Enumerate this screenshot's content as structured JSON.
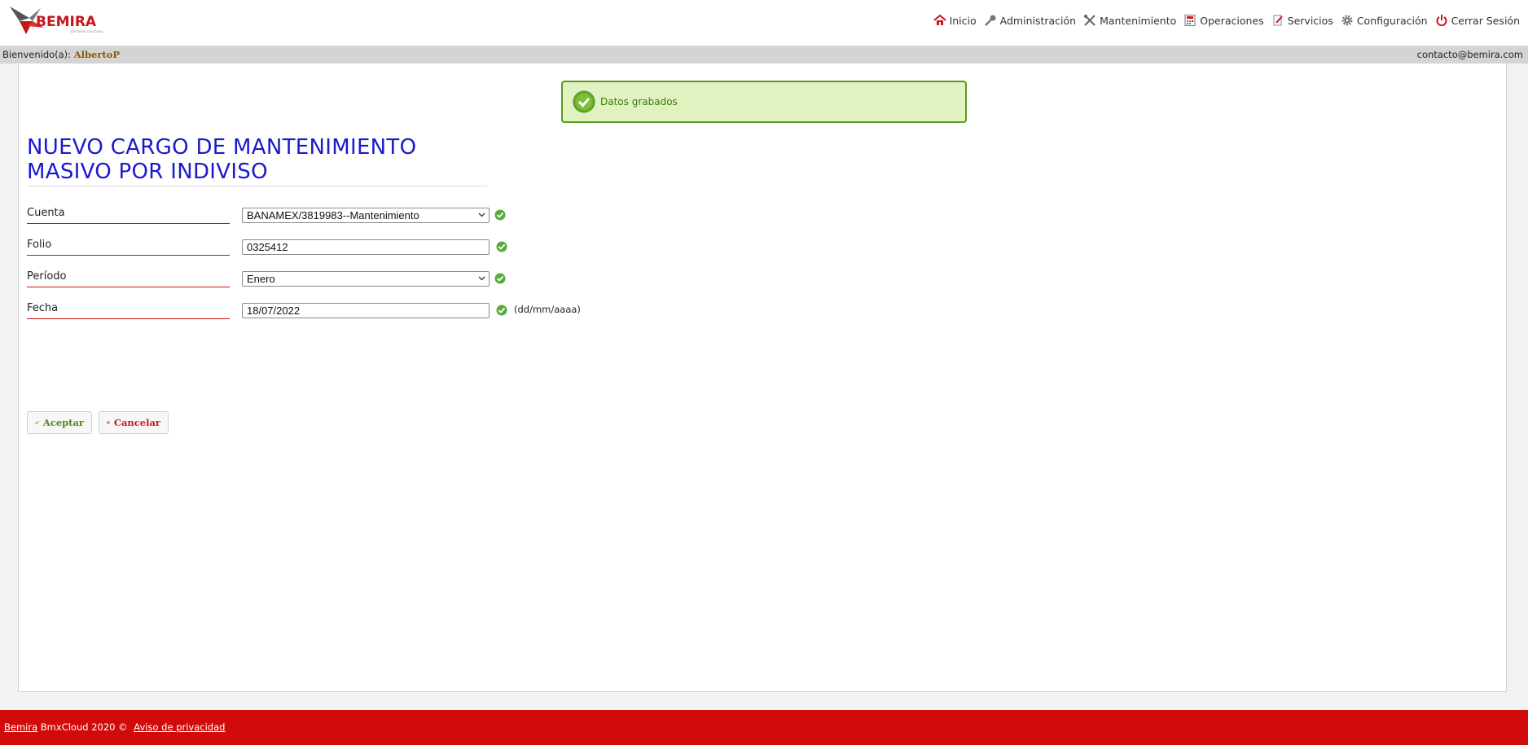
{
  "header": {
    "logo_text": "BEMIRA",
    "nav": [
      {
        "label": "Inicio",
        "icon": "home-icon"
      },
      {
        "label": "Administración",
        "icon": "key-icon"
      },
      {
        "label": "Mantenimiento",
        "icon": "tools-icon"
      },
      {
        "label": "Operaciones",
        "icon": "calculator-icon"
      },
      {
        "label": "Servicios",
        "icon": "document-edit-icon"
      },
      {
        "label": "Configuración",
        "icon": "gear-icon"
      },
      {
        "label": "Cerrar Sesión",
        "icon": "power-icon"
      }
    ]
  },
  "welcome": {
    "prefix": "Bienvenido(a):",
    "user": "AlbertoP",
    "email": "contacto@bemira.com"
  },
  "flash": {
    "message": "Datos grabados"
  },
  "title": {
    "line1": "NUEVO CARGO DE MANTENIMIENTO",
    "line2": "MASIVO POR INDIVISO"
  },
  "form": {
    "cuenta": {
      "label": "Cuenta",
      "value": "BANAMEX/3819983--Mantenimiento"
    },
    "folio": {
      "label": "Folio",
      "value": "0325412"
    },
    "periodo": {
      "label": "Período",
      "value": "Enero"
    },
    "fecha": {
      "label": "Fecha",
      "value": "18/07/2022",
      "hint": "(dd/mm/aaaa)"
    }
  },
  "buttons": {
    "accept": "Aceptar",
    "cancel": "Cancelar"
  },
  "footer": {
    "brand": "Bemira",
    "text": " BmxCloud 2020 © ",
    "privacy": "Aviso de privacidad"
  },
  "colors": {
    "title": "#1a1acc",
    "footer_bg": "#d10a0a",
    "success_bg": "#dff2c0",
    "success_border": "#5a9a1e",
    "label_underline": "#d31010"
  }
}
